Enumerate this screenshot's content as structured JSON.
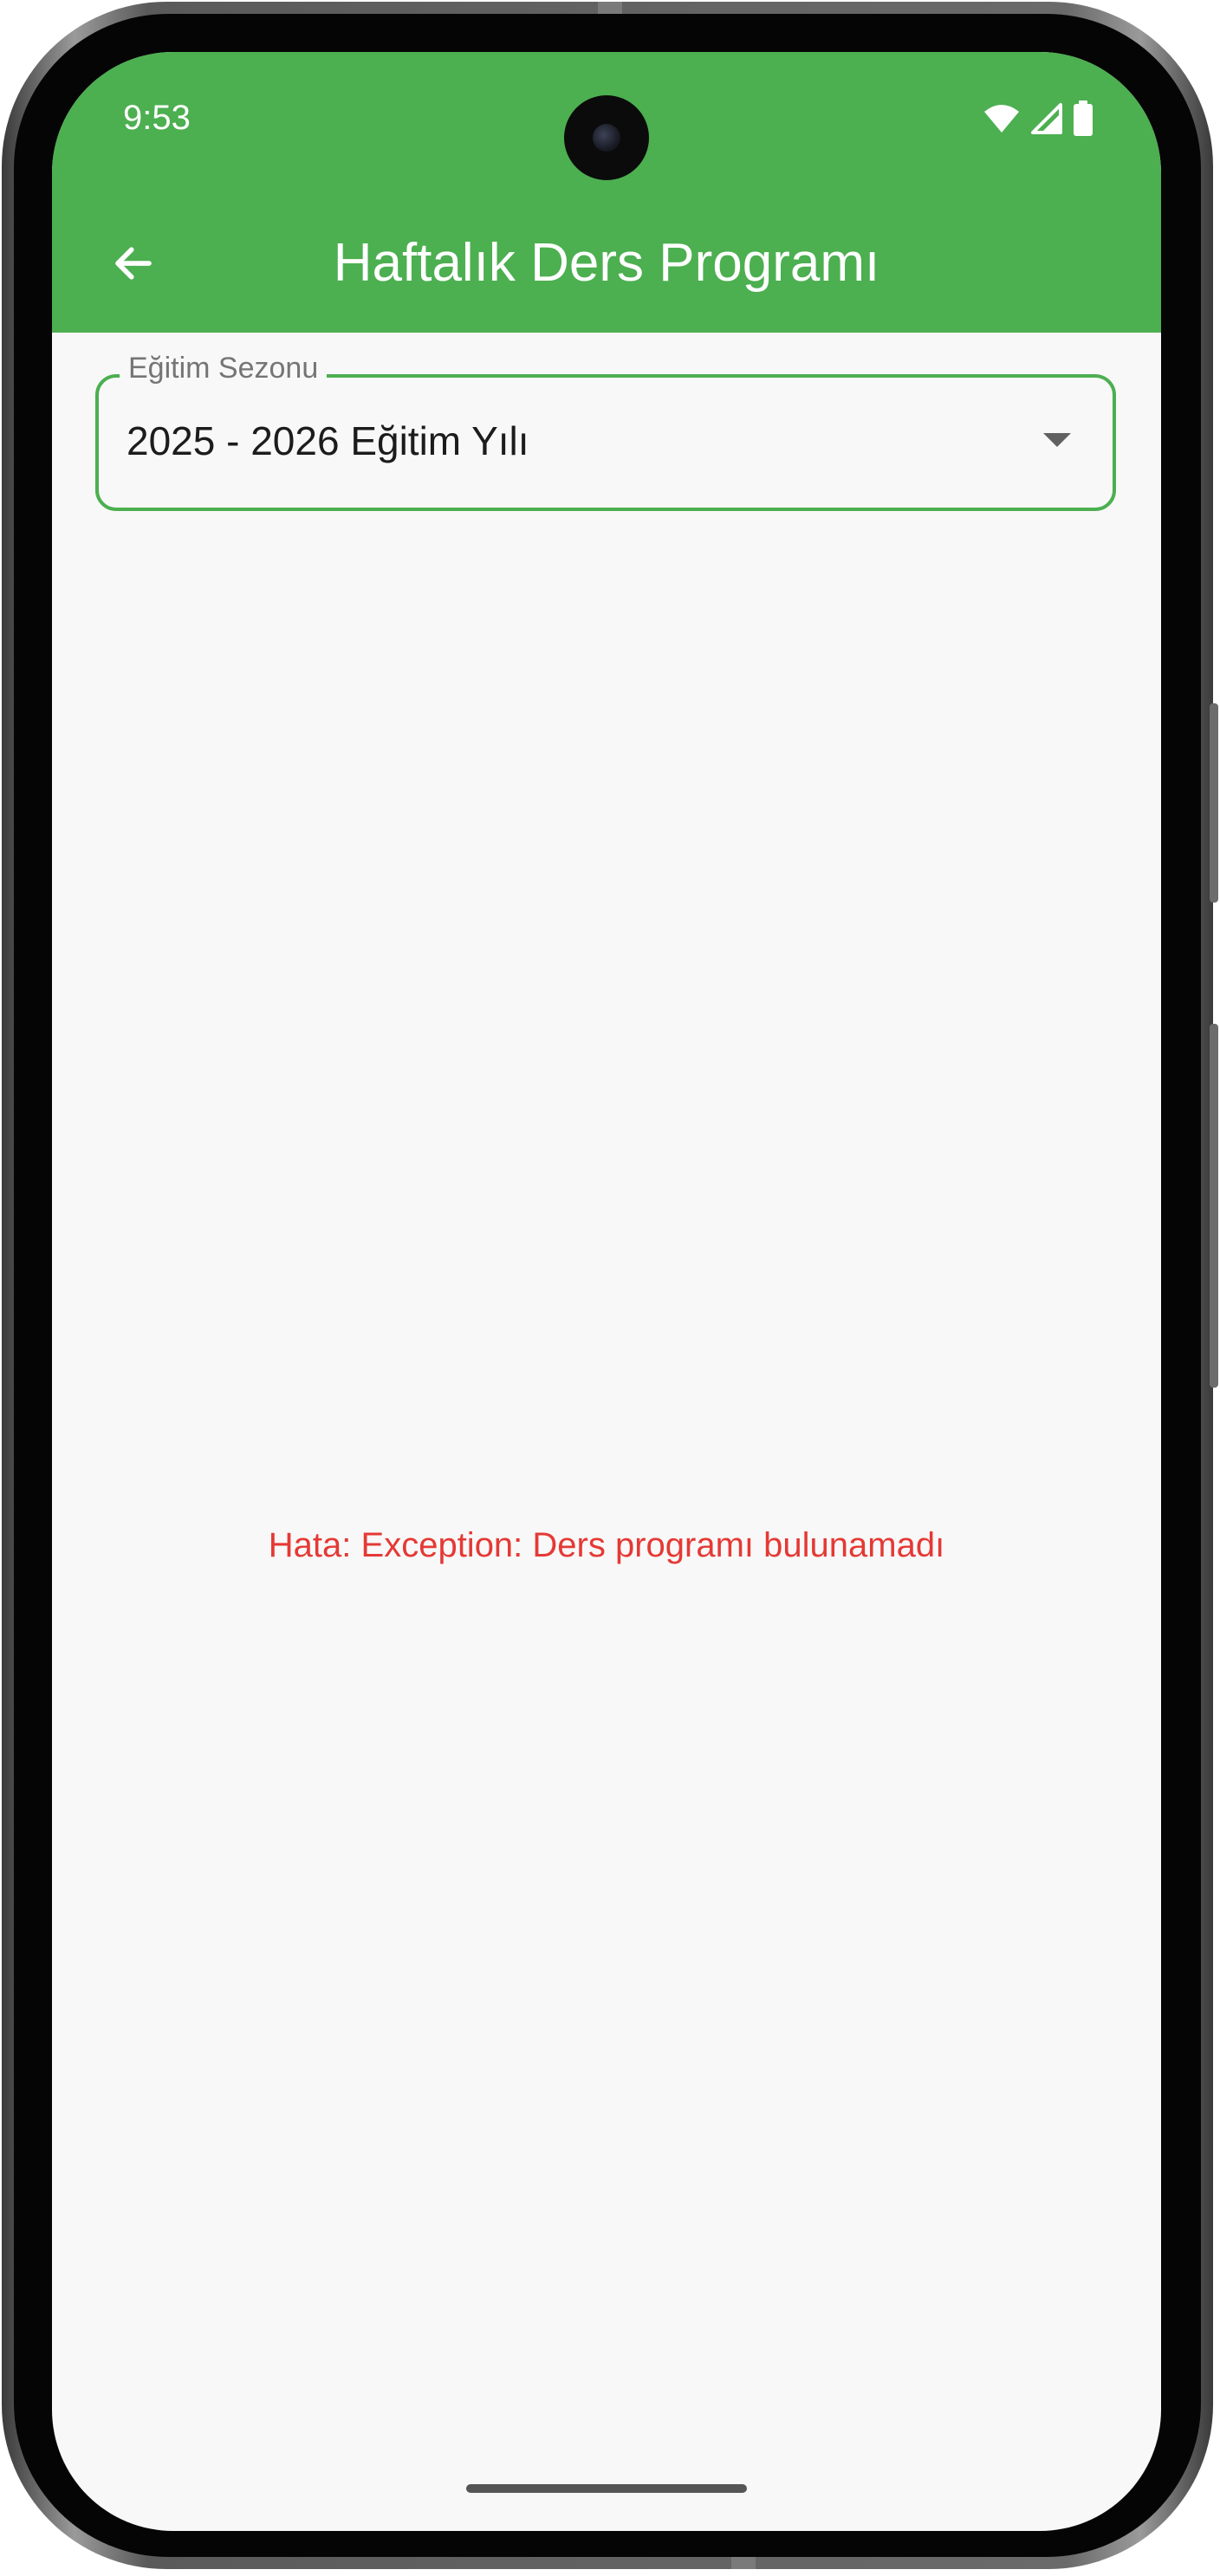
{
  "status_bar": {
    "time": "9:53",
    "icons": [
      "wifi-icon",
      "signal-icon",
      "battery-icon"
    ]
  },
  "app_bar": {
    "back_icon": "arrow-left-icon",
    "title": "Haftalık Ders Programı",
    "background_color": "#4caf50"
  },
  "season_dropdown": {
    "label": "Eğitim Sezonu",
    "selected_value": "2025 - 2026 Eğitim Yılı",
    "icon": "caret-down-icon",
    "border_color": "#4caf50"
  },
  "error": {
    "message": "Hata: Exception: Ders programı bulunamadı",
    "color": "#e53935"
  }
}
